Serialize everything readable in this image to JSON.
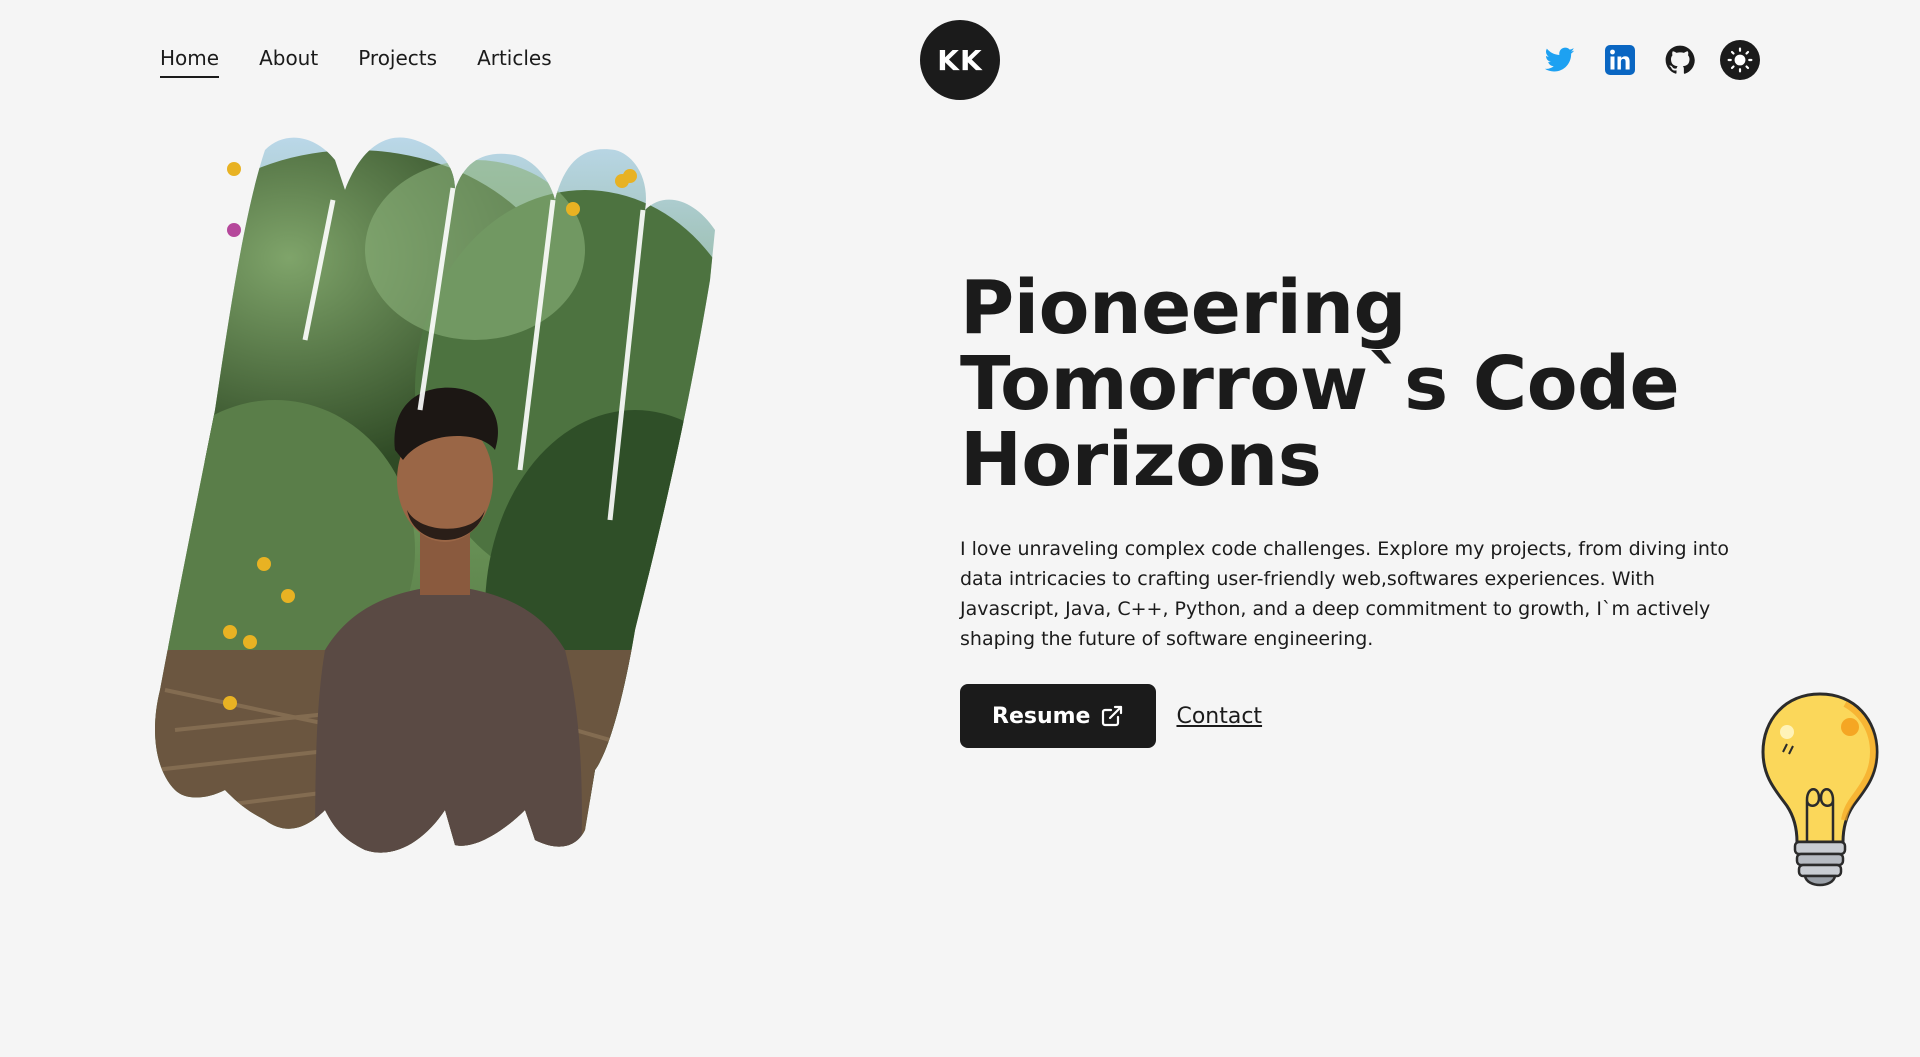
{
  "nav": {
    "links": [
      "Home",
      "About",
      "Projects",
      "Articles"
    ],
    "active": "Home"
  },
  "logo": {
    "text": "KK"
  },
  "socials": {
    "icons": [
      "twitter-icon",
      "linkedin-icon",
      "github-icon",
      "sun-icon"
    ]
  },
  "hero": {
    "title_line1": "Pioneering",
    "title_line2": "Tomorrow`s Code",
    "title_line3": "Horizons",
    "description": "I love unraveling complex code challenges. Explore my projects, from diving into data intricacies to crafting user-friendly web,softwares experiences. With Javascript, Java, C++, Python, and a deep commitment to growth, I`m actively shaping the future of software engineering.",
    "resume_label": "Resume",
    "contact_label": "Contact"
  },
  "colors": {
    "background": "#f5f5f5",
    "text": "#1b1b1b",
    "accent_yellow": "#e8b223",
    "accent_pink": "#b5489b",
    "twitter": "#1da1f2",
    "linkedin": "#0a66c2"
  }
}
